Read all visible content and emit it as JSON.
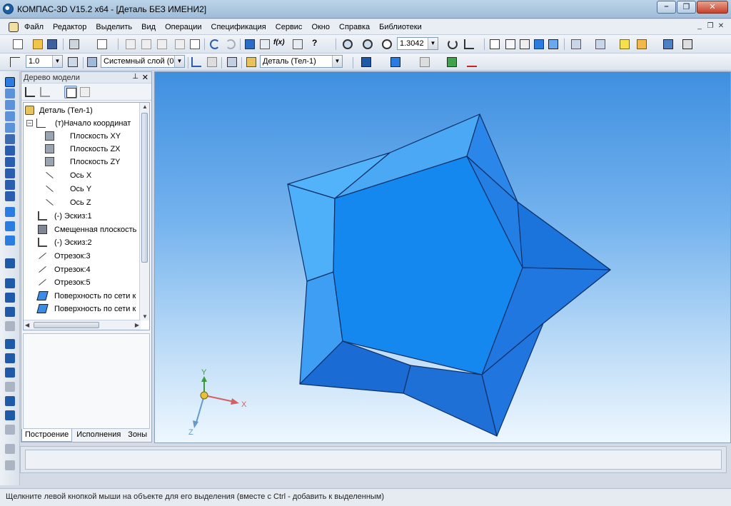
{
  "window": {
    "title": "КОМПАС-3D V15.2  x64 - [Деталь БЕЗ ИМЕНИ2]",
    "minimize_icon": "minimize-icon",
    "maximize_icon": "restore-icon",
    "close_icon": "close-icon"
  },
  "menu": {
    "items": [
      "Файл",
      "Редактор",
      "Выделить",
      "Вид",
      "Операции",
      "Спецификация",
      "Сервис",
      "Окно",
      "Справка",
      "Библиотеки"
    ]
  },
  "toolbar1": {
    "zoom_value": "1.3042"
  },
  "toolbar2": {
    "step_value": "1.0",
    "layer_value": "Системный слой (0)",
    "part_value": "Деталь (Тел-1)"
  },
  "tree_panel": {
    "title": "Дерево модели",
    "items": [
      {
        "label": "Деталь (Тел-1)",
        "icon": "part-icon"
      },
      {
        "label": "(т)Начало координат",
        "icon": "origin-icon"
      },
      {
        "label": "Плоскость XY",
        "icon": "plane-icon"
      },
      {
        "label": "Плоскость ZX",
        "icon": "plane-icon"
      },
      {
        "label": "Плоскость ZY",
        "icon": "plane-icon"
      },
      {
        "label": "Ось X",
        "icon": "axis-icon"
      },
      {
        "label": "Ось Y",
        "icon": "axis-icon"
      },
      {
        "label": "Ось Z",
        "icon": "axis-icon"
      },
      {
        "label": "(-) Эскиз:1",
        "icon": "sketch-icon"
      },
      {
        "label": "Смещенная плоскость",
        "icon": "offset-plane-icon"
      },
      {
        "label": "(-) Эскиз:2",
        "icon": "sketch-icon"
      },
      {
        "label": "Отрезок:3",
        "icon": "segment-icon"
      },
      {
        "label": "Отрезок:4",
        "icon": "segment-icon"
      },
      {
        "label": "Отрезок:5",
        "icon": "segment-icon"
      },
      {
        "label": "Поверхность по сети к",
        "icon": "surface-icon"
      },
      {
        "label": "Поверхность по сети к",
        "icon": "surface-icon"
      }
    ],
    "tabs": [
      "Построение",
      "Исполнения",
      "Зоны"
    ]
  },
  "viewport": {
    "axis_x": "X",
    "axis_y": "Y",
    "axis_z": "Z"
  },
  "status": {
    "text": "Щелкните левой кнопкой мыши на объекте для его выделения (вместе с Ctrl - добавить к выделенным)"
  },
  "colors": {
    "model_light": "#4aa8f5",
    "model_dark": "#1b74dc",
    "edge": "#0d2f66"
  }
}
